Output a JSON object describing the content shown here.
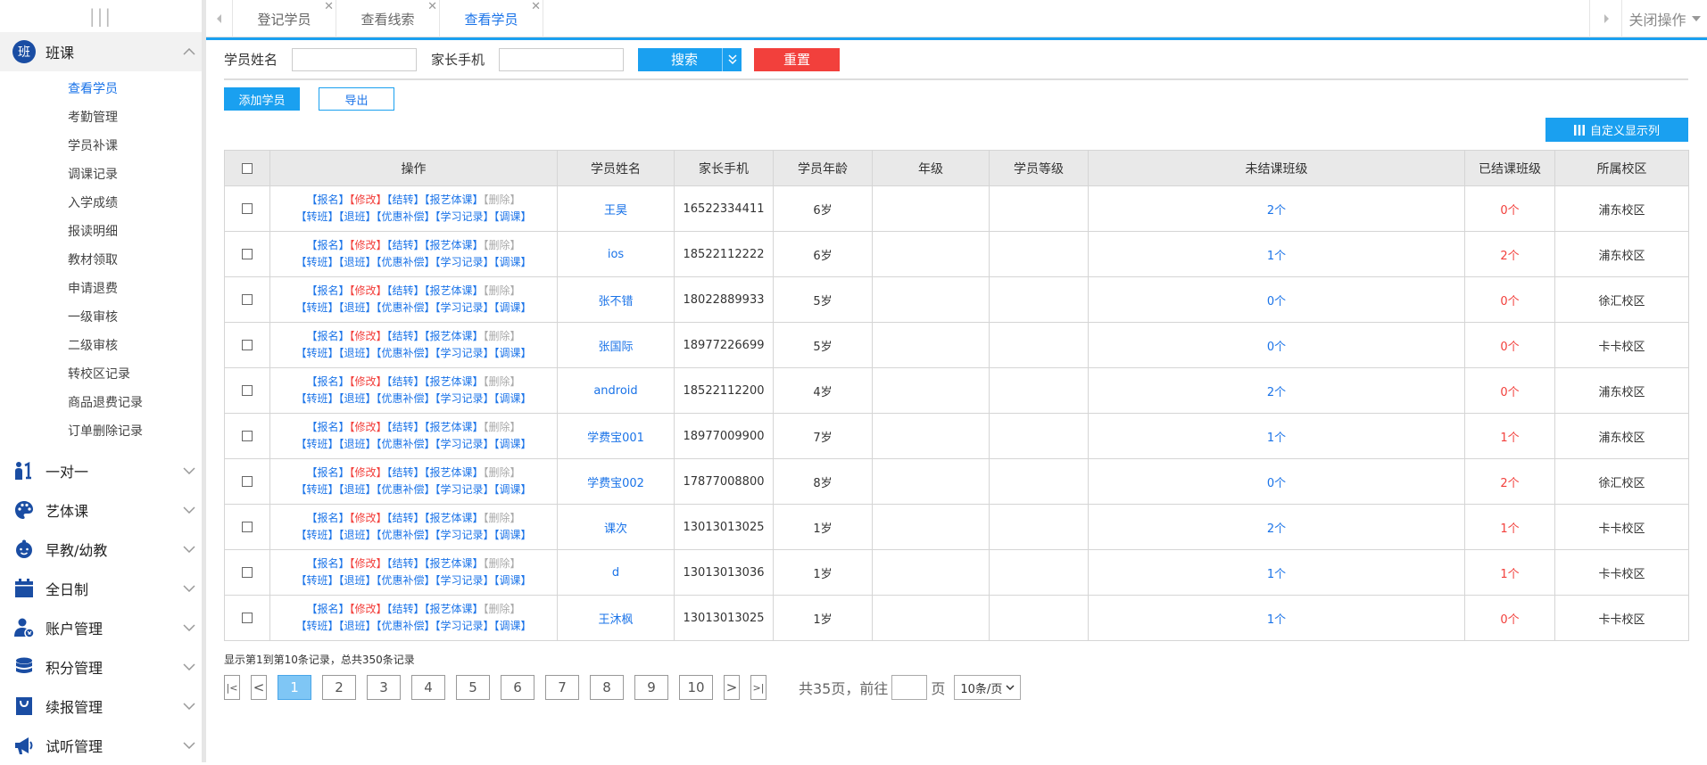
{
  "sidebar": {
    "toggle": "|||",
    "open_group": {
      "label": "班课",
      "icon_char": "班"
    },
    "sub_items": [
      "查看学员",
      "考勤管理",
      "学员补课",
      "调课记录",
      "入学成绩",
      "报读明细",
      "教材领取",
      "申请退费",
      "一级审核",
      "二级审核",
      "转校区记录",
      "商品退费记录",
      "订单删除记录"
    ],
    "groups": [
      {
        "label": "一对一",
        "icon": "one-on-one-icon"
      },
      {
        "label": "艺体课",
        "icon": "palette-icon"
      },
      {
        "label": "早教/幼教",
        "icon": "baby-face-icon"
      },
      {
        "label": "全日制",
        "icon": "calendar-icon"
      },
      {
        "label": "账户管理",
        "icon": "user-account-icon"
      },
      {
        "label": "积分管理",
        "icon": "database-icon"
      },
      {
        "label": "续报管理",
        "icon": "bag-icon"
      },
      {
        "label": "试听管理",
        "icon": "megaphone-icon"
      }
    ]
  },
  "tabs": [
    {
      "label": "登记学员"
    },
    {
      "label": "查看线索"
    },
    {
      "label": "查看学员"
    }
  ],
  "close_all": "关闭操作",
  "filter": {
    "name_label": "学员姓名",
    "phone_label": "家长手机",
    "search": "搜索",
    "reset": "重置"
  },
  "actions": {
    "add": "添加学员",
    "export": "导出",
    "custom_columns": "自定义显示列"
  },
  "table": {
    "headers": [
      "操作",
      "学员姓名",
      "家长手机",
      "学员年龄",
      "年级",
      "学员等级",
      "未结课班级",
      "已结课班级",
      "所属校区"
    ],
    "ops_line1": [
      "【报名】",
      "【修改】",
      "【结转】",
      "【报艺体课】",
      "【删除】"
    ],
    "ops_line2": [
      "【转班】",
      "【退班】",
      "【优惠补偿】",
      "【学习记录】",
      "【调课】"
    ],
    "rows": [
      {
        "name": "王昊",
        "phone": "16522334411",
        "age": "6岁",
        "grade": "",
        "level": "",
        "open": "2个",
        "closed": "0个",
        "campus": "浦东校区"
      },
      {
        "name": "ios",
        "phone": "18522112222",
        "age": "6岁",
        "grade": "",
        "level": "",
        "open": "1个",
        "closed": "2个",
        "campus": "浦东校区"
      },
      {
        "name": "张不错",
        "phone": "18022889933",
        "age": "5岁",
        "grade": "",
        "level": "",
        "open": "0个",
        "closed": "0个",
        "campus": "徐汇校区"
      },
      {
        "name": "张国际",
        "phone": "18977226699",
        "age": "5岁",
        "grade": "",
        "level": "",
        "open": "0个",
        "closed": "0个",
        "campus": "卡卡校区"
      },
      {
        "name": "android",
        "phone": "18522112200",
        "age": "4岁",
        "grade": "",
        "level": "",
        "open": "2个",
        "closed": "0个",
        "campus": "浦东校区"
      },
      {
        "name": "学费宝001",
        "phone": "18977009900",
        "age": "7岁",
        "grade": "",
        "level": "",
        "open": "1个",
        "closed": "1个",
        "campus": "浦东校区"
      },
      {
        "name": "学费宝002",
        "phone": "17877008800",
        "age": "8岁",
        "grade": "",
        "level": "",
        "open": "0个",
        "closed": "2个",
        "campus": "徐汇校区"
      },
      {
        "name": "课次",
        "phone": "13013013025",
        "age": "1岁",
        "grade": "",
        "level": "",
        "open": "2个",
        "closed": "1个",
        "campus": "卡卡校区"
      },
      {
        "name": "d",
        "phone": "13013013036",
        "age": "1岁",
        "grade": "",
        "level": "",
        "open": "1个",
        "closed": "1个",
        "campus": "卡卡校区"
      },
      {
        "name": "王沐枫",
        "phone": "13013013025",
        "age": "1岁",
        "grade": "",
        "level": "",
        "open": "1个",
        "closed": "0个",
        "campus": "卡卡校区"
      }
    ]
  },
  "pagination": {
    "summary": "显示第1到第10条记录，总共350条记录",
    "first": "|<",
    "prev": "<",
    "next": ">",
    "last": ">|",
    "pages": [
      "1",
      "2",
      "3",
      "4",
      "5",
      "6",
      "7",
      "8",
      "9",
      "10"
    ],
    "current": "1",
    "total_text": "共35页，前往",
    "page_unit": "页",
    "page_size": "10条/页"
  },
  "colors": {
    "accent": "#1aa0f0",
    "danger": "#f2403c",
    "link": "#1a73e8"
  }
}
